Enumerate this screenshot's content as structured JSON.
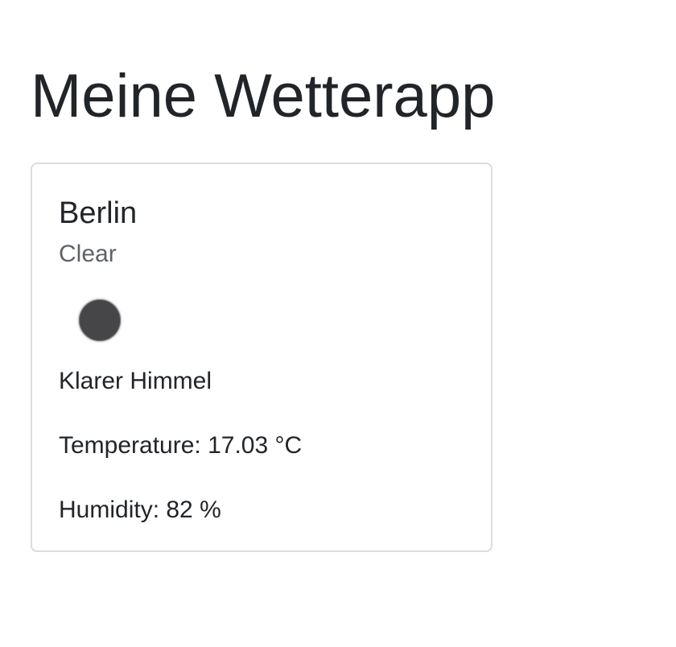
{
  "app": {
    "title": "Meine Wetterapp"
  },
  "weather_card": {
    "city": "Berlin",
    "condition_main": "Clear",
    "icon": "dark-circle-weather-icon",
    "description": "Klarer Himmel",
    "temperature_text": "Temperature: 17.03 °C",
    "humidity_text": "Humidity: 82 %"
  },
  "colors": {
    "text": "#212529",
    "muted_text": "#5f6368",
    "card_border": "#dcdcdc",
    "icon_fill": "#464649"
  }
}
